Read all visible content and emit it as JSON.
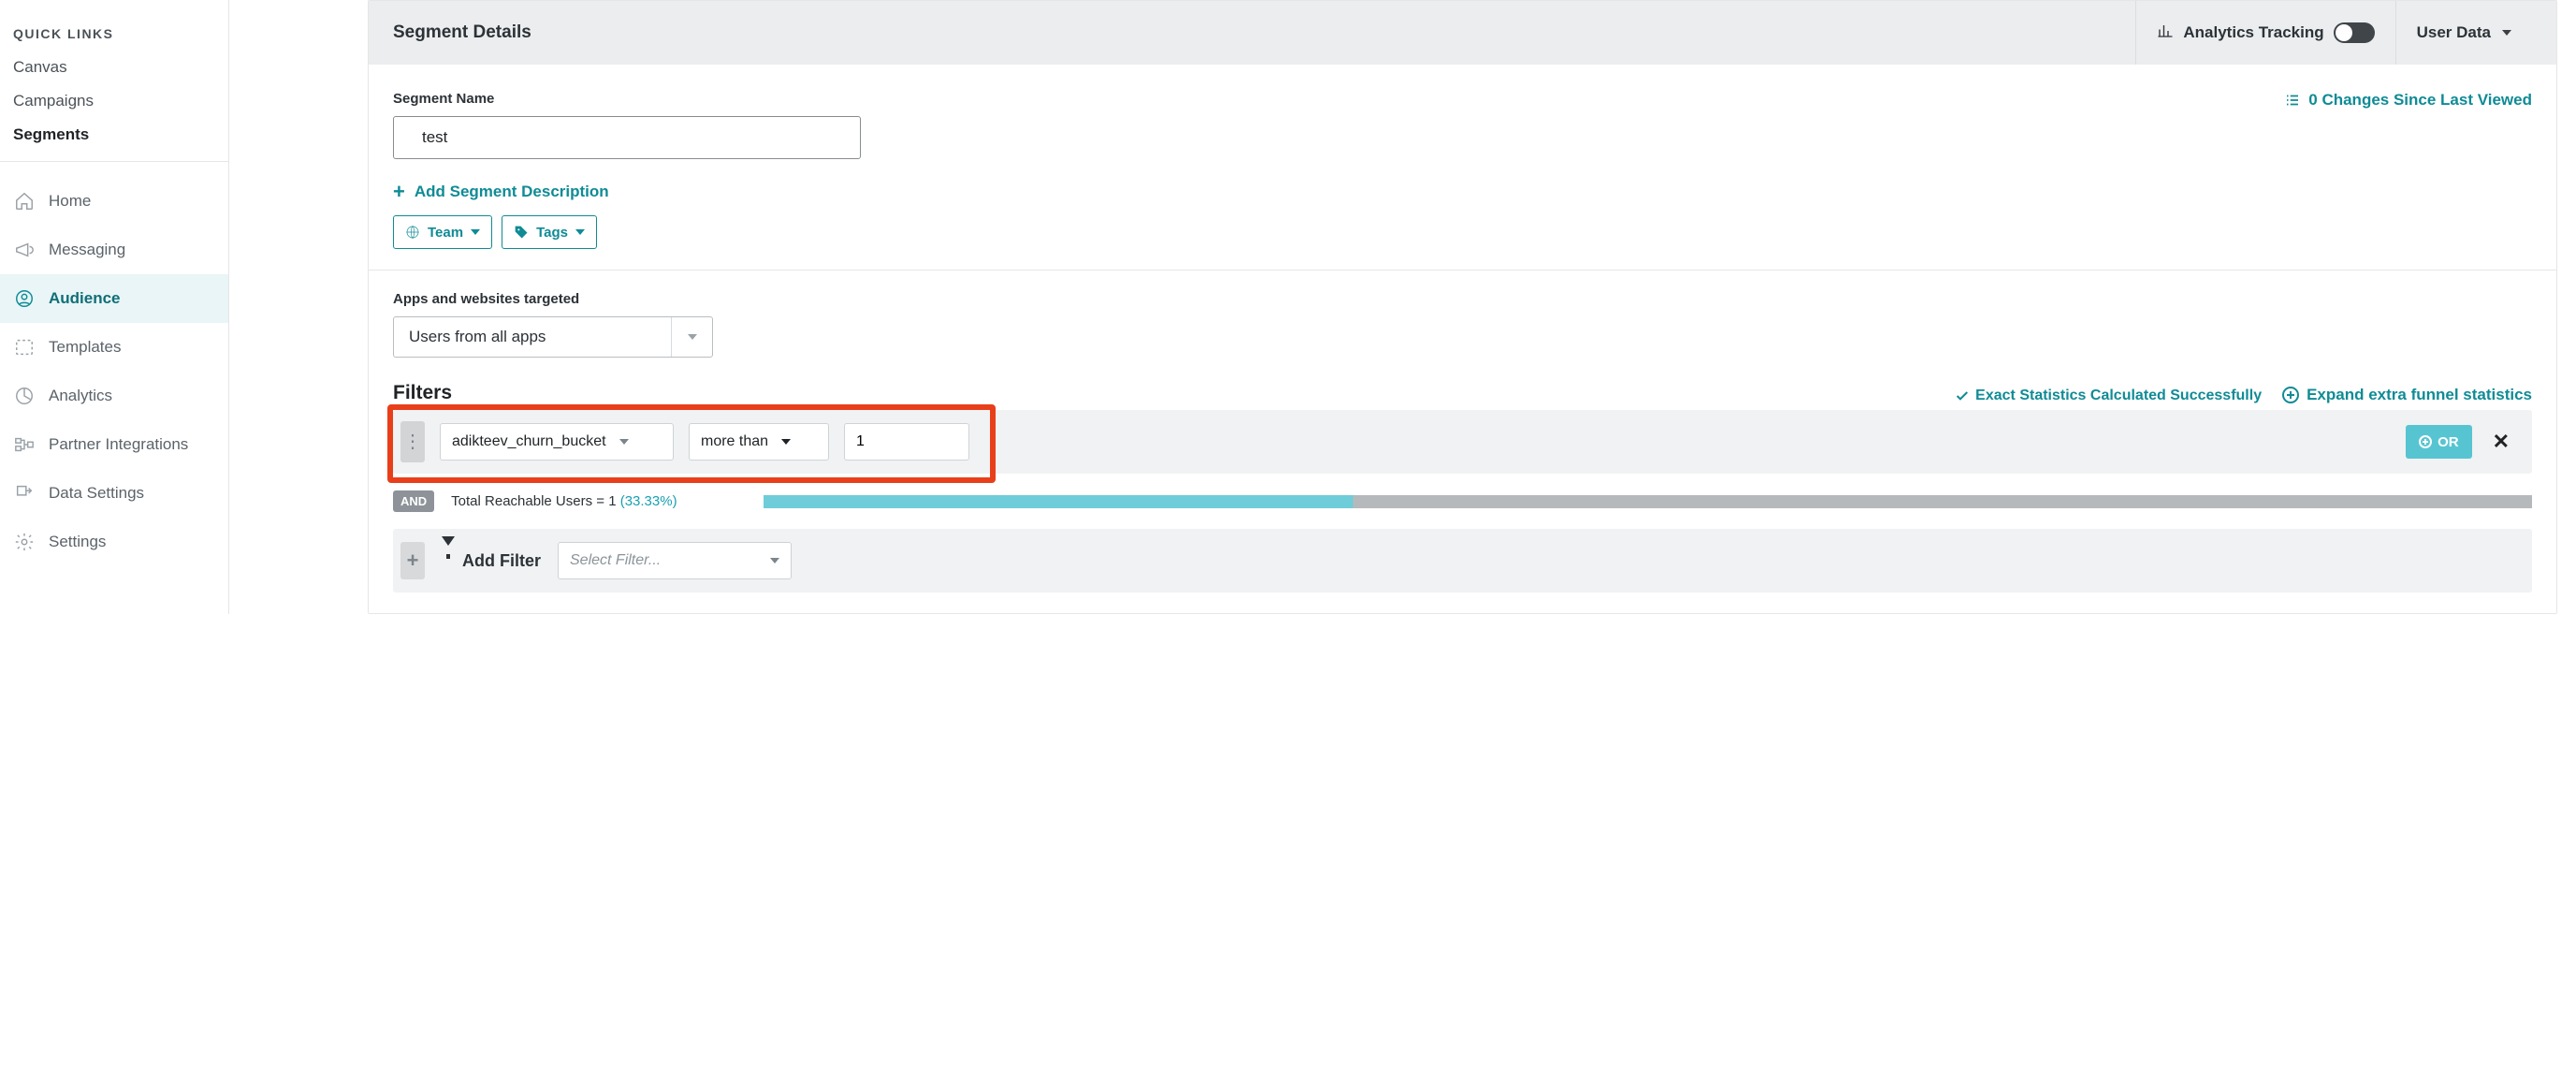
{
  "sidebar": {
    "quick_links_header": "QUICK LINKS",
    "quick_links": [
      "Canvas",
      "Campaigns",
      "Segments"
    ],
    "quick_links_selected_index": 2,
    "nav": [
      {
        "label": "Home"
      },
      {
        "label": "Messaging"
      },
      {
        "label": "Audience",
        "active": true
      },
      {
        "label": "Templates"
      },
      {
        "label": "Analytics"
      },
      {
        "label": "Partner Integrations"
      },
      {
        "label": "Data Settings"
      },
      {
        "label": "Settings"
      }
    ]
  },
  "header": {
    "title": "Segment Details",
    "analytics_label": "Analytics Tracking",
    "analytics_enabled": false,
    "userdata_label": "User Data"
  },
  "segment": {
    "name_label": "Segment Name",
    "name_value": "test",
    "changes_text": "0 Changes Since Last Viewed",
    "add_description": "Add Segment Description",
    "team_chip": "Team",
    "tags_chip": "Tags",
    "apps_label": "Apps and websites targeted",
    "apps_value": "Users from all apps"
  },
  "filters": {
    "title": "Filters",
    "success_text": "Exact Statistics Calculated Successfully",
    "expand_text": "Expand extra funnel statistics",
    "rows": [
      {
        "attribute": "adikteev_churn_bucket",
        "operator": "more than",
        "value": "1"
      }
    ],
    "or_label": "OR",
    "and_label": "AND",
    "reach_prefix": "Total Reachable Users = ",
    "reach_value": "1",
    "reach_pct": "(33.33%)",
    "reach_fill_pct": 33.33,
    "add_filter_label": "Add Filter",
    "add_filter_placeholder": "Select Filter..."
  }
}
